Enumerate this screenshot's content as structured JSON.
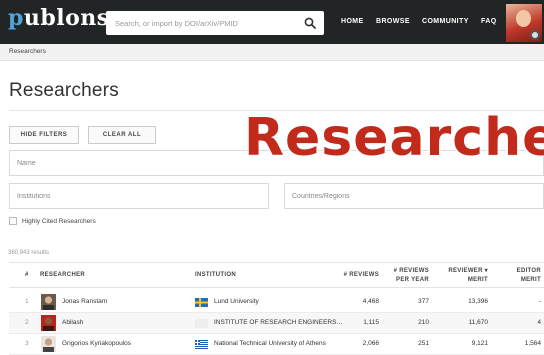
{
  "header": {
    "logo": "publons",
    "search_placeholder": "Search, or import by DOI/arXiv/PMID",
    "nav": [
      "HOME",
      "BROWSE",
      "COMMUNITY",
      "FAQ"
    ],
    "icons": {
      "search": "search-icon",
      "avatar": "user-avatar",
      "settings": "gear-icon"
    }
  },
  "breadcrumb": "Researchers",
  "page": {
    "title": "Researchers",
    "buttons": {
      "hide_filters": "HIDE FILTERS",
      "clear_all": "CLEAR ALL"
    },
    "filters": {
      "name_placeholder": "Name",
      "institutions_placeholder": "Institutions",
      "countries_placeholder": "Countries/Regions",
      "highly_cited_label": "Highly Cited Researchers"
    },
    "results_count": "360,943 results"
  },
  "overlay_text": "Researche",
  "table": {
    "headers": {
      "rank": "#",
      "researcher": "RESEARCHER",
      "institution": "INSTITUTION",
      "reviews": "# REVIEWS",
      "reviews_per_year_1": "# REVIEWS",
      "reviews_per_year_2": "PER YEAR",
      "reviewer_merit_1": "REVIEWER ▾",
      "reviewer_merit_2": "MERIT",
      "editor_merit_1": "EDITOR",
      "editor_merit_2": "MERIT"
    },
    "rows": [
      {
        "rank": "1",
        "name": "Jonas Ranstam",
        "institution": "Lund University",
        "flag": "sweden",
        "reviews": "4,468",
        "per_year": "377",
        "reviewer_merit": "13,396",
        "editor_merit": "-"
      },
      {
        "rank": "2",
        "name": "Abilash",
        "institution": "INSTITUTE OF RESEARCH ENGINEERS…",
        "flag": "none",
        "reviews": "1,115",
        "per_year": "210",
        "reviewer_merit": "11,670",
        "editor_merit": "4"
      },
      {
        "rank": "3",
        "name": "Grigorios Kyriakopoulos",
        "institution": "National Technical University of Athens",
        "flag": "greece",
        "reviews": "2,066",
        "per_year": "251",
        "reviewer_merit": "9,121",
        "editor_merit": "1,564"
      }
    ]
  },
  "colors": {
    "topbar": "#222526",
    "logo_accent": "#4fa3d9",
    "overlay": "#c22a1c"
  }
}
